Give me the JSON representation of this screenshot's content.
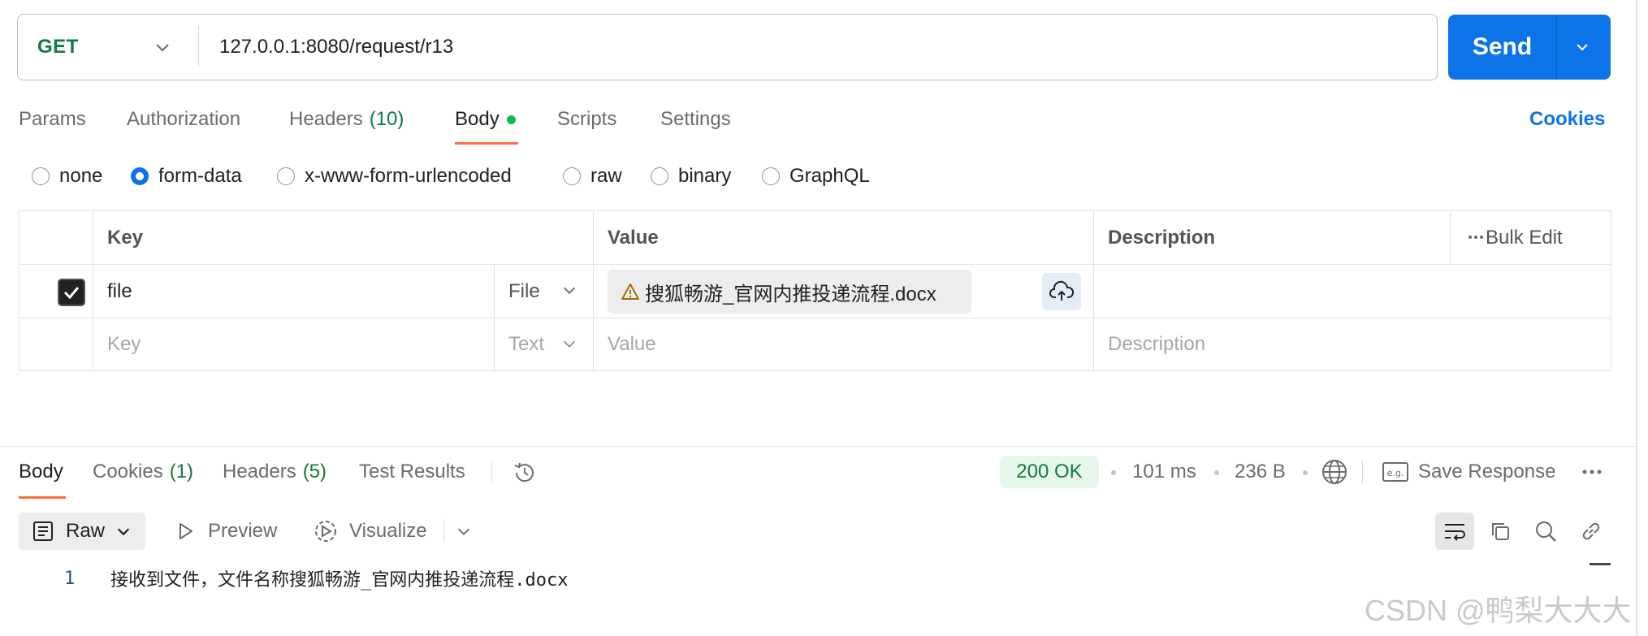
{
  "request": {
    "method": "GET",
    "url": "127.0.0.1:8080/request/r13",
    "send_label": "Send"
  },
  "request_tabs": {
    "params": "Params",
    "authorization": "Authorization",
    "headers": "Headers",
    "headers_count": "(10)",
    "body": "Body",
    "scripts": "Scripts",
    "settings": "Settings",
    "cookies": "Cookies"
  },
  "body_types": {
    "none": "none",
    "form_data": "form-data",
    "urlencoded": "x-www-form-urlencoded",
    "raw": "raw",
    "binary": "binary",
    "graphql": "GraphQL",
    "selected": "form-data"
  },
  "form_table": {
    "headers": {
      "key": "Key",
      "value": "Value",
      "description": "Description",
      "bulk_edit": "Bulk Edit"
    },
    "row": {
      "key": "file",
      "type": "File",
      "value": "搜狐畅游_官网内推投递流程.docx",
      "checked": true
    },
    "empty_row": {
      "key_placeholder": "Key",
      "type": "Text",
      "value_placeholder": "Value",
      "description_placeholder": "Description"
    }
  },
  "response": {
    "tabs": {
      "body": "Body",
      "cookies": "Cookies",
      "cookies_count": "(1)",
      "headers": "Headers",
      "headers_count": "(5)",
      "test_results": "Test Results"
    },
    "status": "200 OK",
    "time": "101 ms",
    "size": "236 B",
    "save_response": "Save Response",
    "format": "Raw",
    "preview": "Preview",
    "visualize": "Visualize",
    "line_number": "1",
    "body_text": "接收到文件，文件名称搜狐畅游_官网内推投递流程.docx"
  },
  "watermark": "CSDN @鸭梨大大大",
  "colors": {
    "accent_blue": "#0d74e7",
    "tab_orange": "#ff6c37",
    "success_green": "#0f7b3e"
  }
}
